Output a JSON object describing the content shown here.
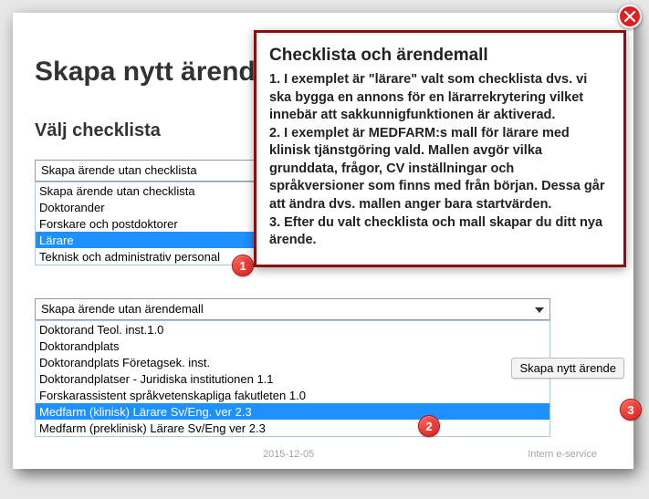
{
  "page": {
    "title": "Skapa nytt ärende",
    "section_checklist": "Välj checklista",
    "create_button": "Skapa nytt ärende"
  },
  "close": {
    "label": "Stäng"
  },
  "checklist_dropdown": {
    "selected": "Skapa ärende utan checklista",
    "options": [
      "Skapa ärende utan checklista",
      "Doktorander",
      "Forskare och postdoktorer",
      "Lärare",
      "Teknisk och administrativ personal"
    ],
    "selected_index": 3
  },
  "template_dropdown": {
    "selected": "Skapa ärende utan ärendemall",
    "options": [
      "Doktorand Teol. inst.1.0",
      "Doktorandplats",
      "Doktorandplats Företagsek. inst.",
      "Doktorandplatser - Juridiska institutionen 1.1",
      "Forskarassistent språkvetenskapliga fakutleten 1.0",
      "Medfarm (klinisk) Lärare Sv/Eng. ver 2.3",
      "Medfarm (preklinisk) Lärare Sv/Eng ver 2.3"
    ],
    "selected_index": 5
  },
  "badges": {
    "b1": "1",
    "b2": "2",
    "b3": "3"
  },
  "callout": {
    "title": "Checklista och ärendemall",
    "body": "1. I exemplet är \"lärare\" valt som checklista dvs. vi ska bygga en annons för en lärarrekrytering vilket innebär att sakkunnigfunktionen är aktiverad.\n2. I exemplet är MEDFARM:s mall för lärare med klinisk tjänstgöring vald. Mallen avgör vilka grunddata, frågor, CV inställningar och språkversioner som finns med från början. Dessa går att ändra dvs. mallen anger bara startvärden.\n3. Efter du valt checklista och mall skapar du ditt nya ärende."
  },
  "bgrow": {
    "a": "2015-12-05",
    "b": "",
    "c": "Intern e-service"
  }
}
